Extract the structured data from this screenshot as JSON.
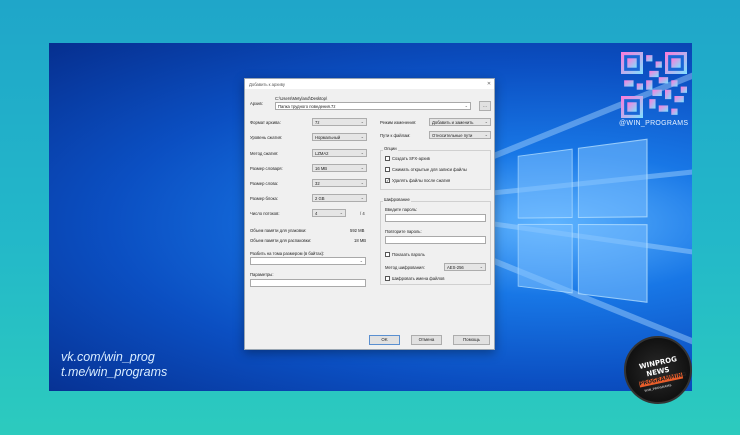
{
  "dialog": {
    "title": "Добавить к архиву",
    "archive_label": "Архив:",
    "archive_path": "C:\\Users\\Metyland\\Desktop\\",
    "archive_name": "Папка трудного поведения.7z",
    "browse_label": "...",
    "format_label": "Формат архива:",
    "format_value": "7z",
    "level_label": "Уровень сжатия:",
    "level_value": "Нормальный",
    "method_label": "Метод сжатия:",
    "method_value": "LZMA2",
    "dict_label": "Размер словаря:",
    "dict_value": "16 MB",
    "word_label": "Размер слова:",
    "word_value": "32",
    "block_label": "Размер блока:",
    "block_value": "2 GB",
    "threads_label": "Число потоков:",
    "threads_value": "4",
    "threads_max": "/ 4",
    "mem_pack_label": "Объем памяти для упаковки:",
    "mem_pack_value": "592 MB",
    "mem_unpack_label": "Объем памяти для распаковки:",
    "mem_unpack_value": "18 MB",
    "split_label": "Разбить на тома размером (в байтах):",
    "params_label": "Параметры:",
    "update_label": "Режим изменения:",
    "update_value": "Добавить и заменить",
    "paths_label": "Пути к файлам:",
    "paths_value": "Относительные пути",
    "options_label": "Опции",
    "opt_sfx": "Создать SFX-архив",
    "opt_shared": "Сжимать открытые для записи файлы",
    "opt_delete": "Удалять файлы после сжатия",
    "encryption_label": "Шифрование",
    "pw_label": "Введите пароль:",
    "pw_repeat_label": "Повторите пароль:",
    "show_pw": "Показать пароль",
    "enc_method_label": "Метод шифрования:",
    "enc_method_value": "AES-256",
    "enc_names": "Шифровать имена файлов",
    "ok": "OK",
    "cancel": "Отмена",
    "help": "Помощь"
  },
  "overlay": {
    "qr_caption": "@WIN_PROGRAMS",
    "link_vk": "vk.com/win_prog",
    "link_tg": "t.me/win_programs",
    "badge_line1": "WINPROG",
    "badge_line2": "NEWS",
    "badge_line3": "PROGRAMMING",
    "badge_line4": "WIN_PROGRAMS"
  }
}
